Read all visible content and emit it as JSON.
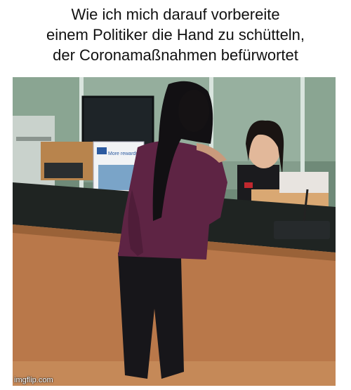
{
  "caption": {
    "lines": [
      "Wie ich mich darauf vorbereite",
      "einem Politiker die Hand zu schütteln,",
      "der Coronamaßnahmen befürwortet"
    ]
  },
  "photo": {
    "sign_text": "More rewards",
    "watermark": "imgflip.com"
  },
  "colors": {
    "counter_wood": "#b9784a",
    "sweater": "#5e2444",
    "wall_green": "#7b9a84"
  }
}
